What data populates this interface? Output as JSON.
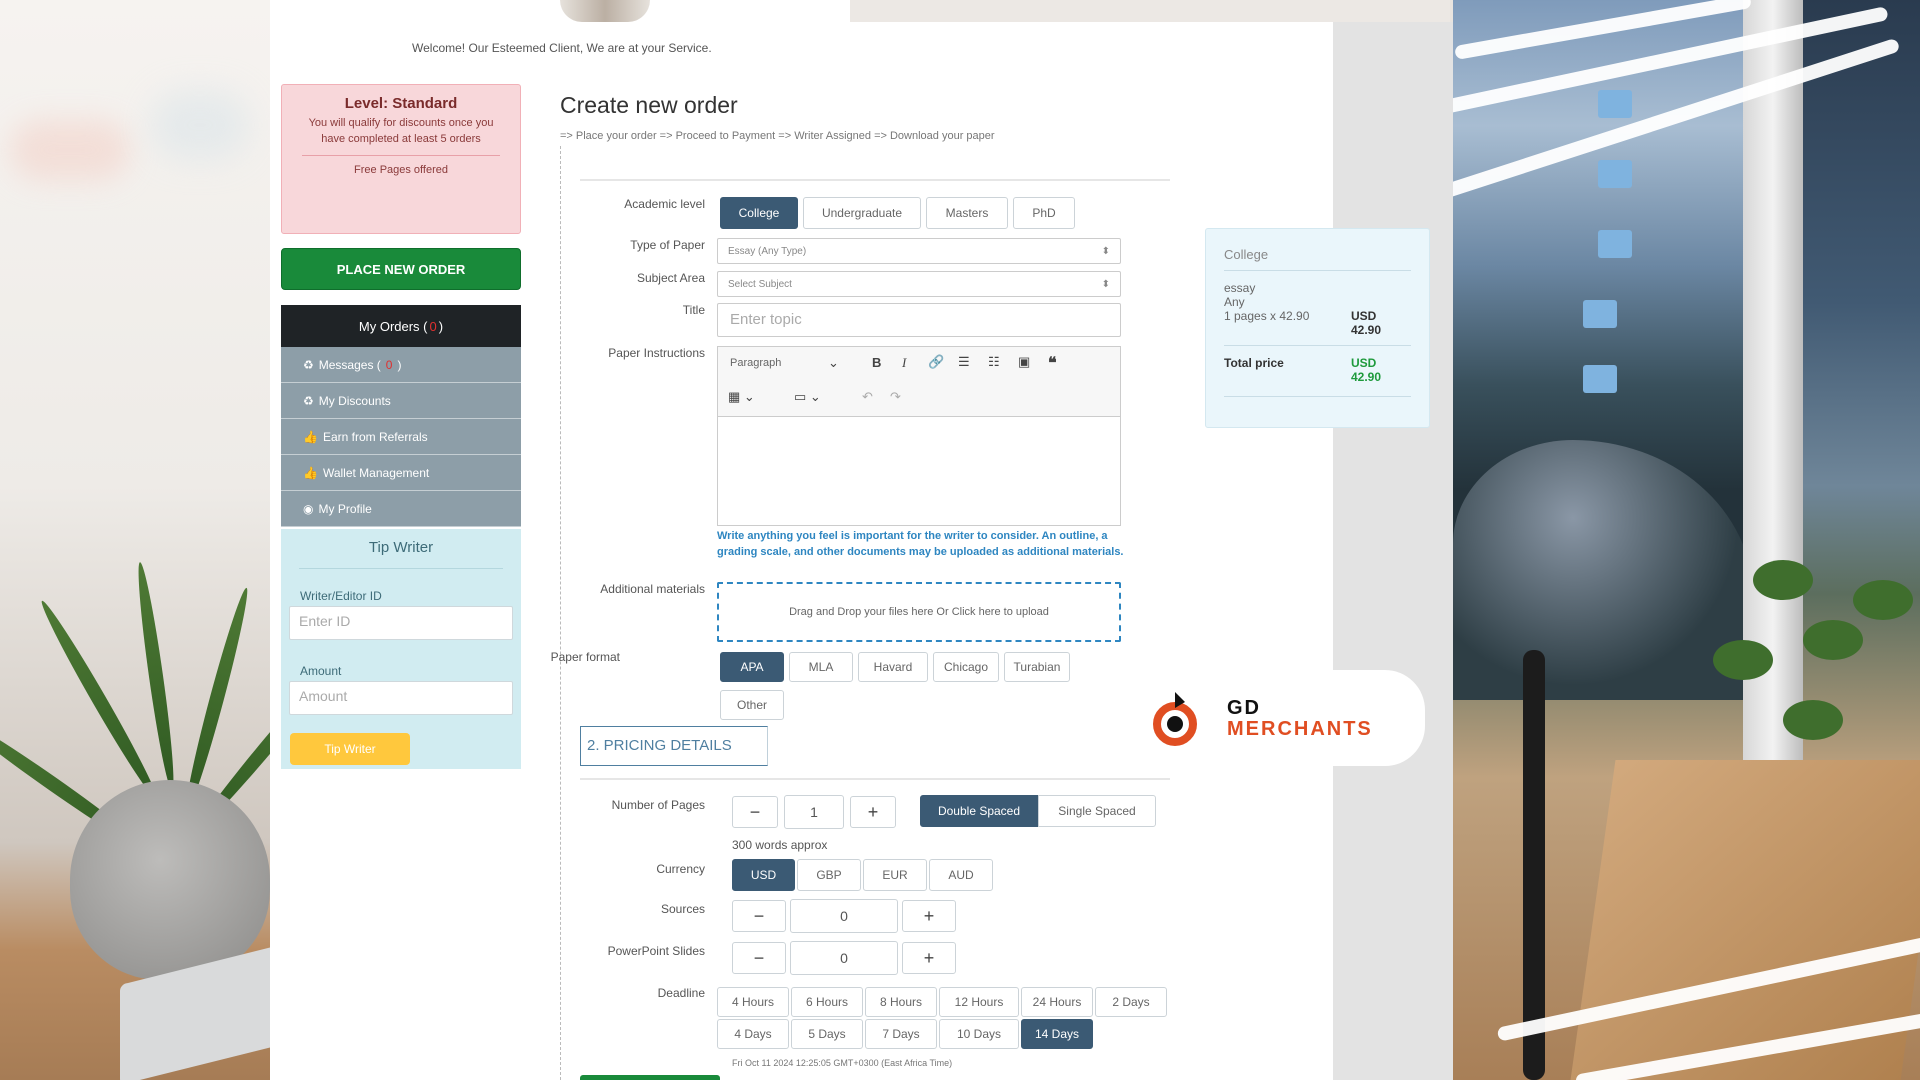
{
  "welcome": "Welcome! Our Esteemed Client, We are at your Service.",
  "level": {
    "title": "Level: Standard",
    "description": "You will qualify for discounts once you have completed at least 5 orders",
    "free_pages": "Free Pages offered"
  },
  "place_order_label": "PLACE NEW ORDER",
  "my_orders": {
    "label": "My Orders (",
    "count": "0",
    "suffix": ")"
  },
  "menu": [
    {
      "label": "Messages (",
      "count": "0",
      "suffix": ")",
      "icon": "recycle-icon"
    },
    {
      "label": "My Discounts",
      "icon": "recycle-icon"
    },
    {
      "label": "Earn from Referrals",
      "icon": "thumbs-up-icon"
    },
    {
      "label": "Wallet Management",
      "icon": "thumbs-up-icon"
    },
    {
      "label": "My Profile",
      "icon": "user-circle-icon"
    }
  ],
  "tip": {
    "title": "Tip Writer",
    "writer_label": "Writer/Editor ID",
    "writer_placeholder": "Enter ID",
    "amount_label": "Amount",
    "amount_placeholder": "Amount",
    "button": "Tip Writer"
  },
  "form": {
    "title": "Create new order",
    "steps": "=> Place your order => Proceed to Payment => Writer Assigned => Download your paper",
    "academic_label": "Academic level",
    "academic_levels": [
      "College",
      "Undergraduate",
      "Masters",
      "PhD"
    ],
    "academic_selected": "College",
    "type_label": "Type of Paper",
    "type_value": "Essay (Any Type)",
    "subject_label": "Subject Area",
    "subject_value": "Select Subject",
    "title_label": "Title",
    "title_placeholder": "Enter topic",
    "instructions_label": "Paper Instructions",
    "editor_paragraph": "Paragraph",
    "instructions_help": "Write anything you feel is important for the writer to consider. An outline, a grading scale, and other documents may be uploaded as additional materials.",
    "materials_label": "Additional materials",
    "drop_text": "Drag and Drop your files here Or Click here to upload",
    "format_label": "Paper format",
    "formats": [
      "APA",
      "MLA",
      "Havard",
      "Chicago",
      "Turabian",
      "Other"
    ],
    "format_selected": "APA",
    "pricing_title": "2. PRICING DETAILS",
    "pages_label": "Number of Pages",
    "pages_value": "1",
    "spacing": [
      "Double Spaced",
      "Single Spaced"
    ],
    "spacing_selected": "Double Spaced",
    "words_note": "300 words approx",
    "currency_label": "Currency",
    "currencies": [
      "USD",
      "GBP",
      "EUR",
      "AUD"
    ],
    "currency_selected": "USD",
    "sources_label": "Sources",
    "sources_value": "0",
    "slides_label": "PowerPoint Slides",
    "slides_value": "0",
    "deadline_label": "Deadline",
    "deadlines_row1": [
      "4 Hours",
      "6 Hours",
      "8 Hours",
      "12 Hours",
      "24 Hours",
      "2 Days"
    ],
    "deadlines_row2": [
      "4 Days",
      "5 Days",
      "7 Days",
      "10 Days",
      "14 Days"
    ],
    "deadline_selected": "14 Days",
    "deadline_note": "Fri Oct 11 2024 12:25:05 GMT+0300 (East Africa Time)",
    "minus": "−",
    "plus": "+"
  },
  "summary": {
    "level": "College",
    "type": "essay",
    "subject": "Any",
    "calc": "1 pages x 42.90",
    "calc_price_cur": "USD",
    "calc_price": "42.90",
    "total_label": "Total price",
    "total_cur": "USD",
    "total_price": "42.90"
  },
  "logo": {
    "line1": "GD",
    "line2": "MERCHANTS"
  },
  "colors": {
    "accent": "#3b5a74",
    "green": "#198a3a",
    "danger": "#e0302f",
    "brand_orange": "#e04e22"
  }
}
